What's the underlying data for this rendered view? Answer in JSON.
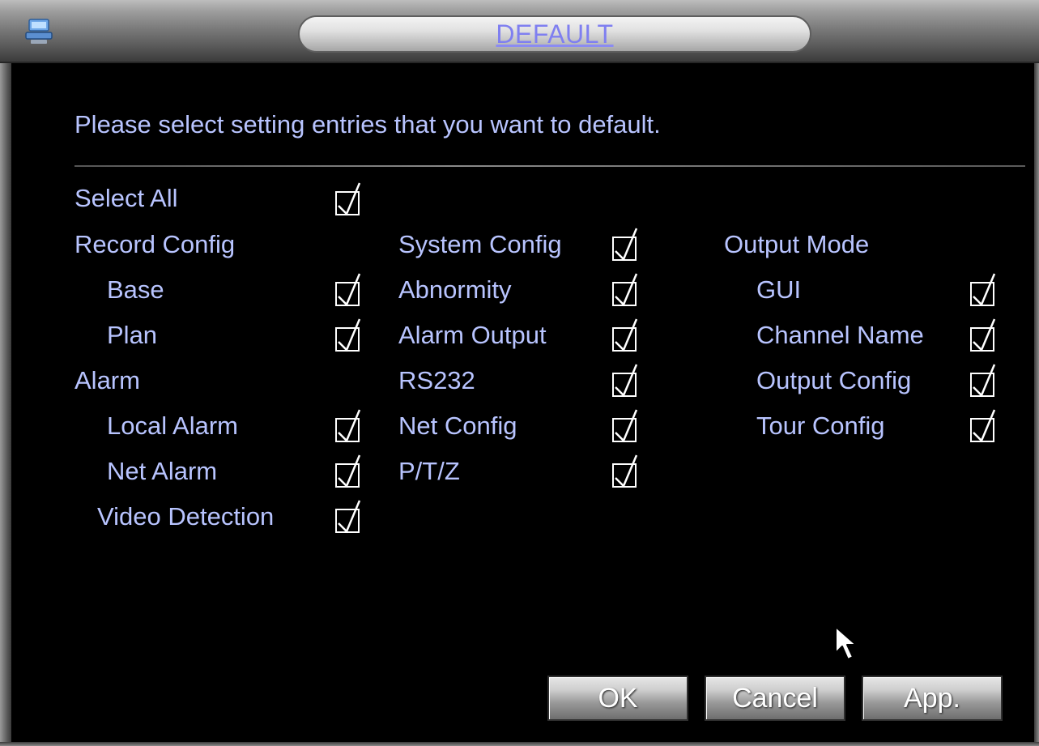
{
  "window": {
    "title": "DEFAULT"
  },
  "prompt": "Please select setting entries that you want to default.",
  "select_all": {
    "label": "Select All",
    "checked": true
  },
  "columns": {
    "left": {
      "group1": {
        "label": "Record Config"
      },
      "base": {
        "label": "Base",
        "checked": true
      },
      "plan": {
        "label": "Plan",
        "checked": true
      },
      "group2": {
        "label": "Alarm"
      },
      "local_alarm": {
        "label": "Local Alarm",
        "checked": true
      },
      "net_alarm": {
        "label": "Net Alarm",
        "checked": true
      },
      "video_detection": {
        "label": "Video Detection",
        "checked": true
      }
    },
    "middle": {
      "system_config": {
        "label": "System Config",
        "checked": true
      },
      "abnormity": {
        "label": "Abnormity",
        "checked": true
      },
      "alarm_output": {
        "label": "Alarm Output",
        "checked": true
      },
      "rs232": {
        "label": "RS232",
        "checked": true
      },
      "net_config": {
        "label": "Net Config",
        "checked": true
      },
      "ptz": {
        "label": "P/T/Z",
        "checked": true
      }
    },
    "right": {
      "group1": {
        "label": "Output Mode"
      },
      "gui": {
        "label": "GUI",
        "checked": true
      },
      "channel_name": {
        "label": "Channel Name",
        "checked": true
      },
      "output_config": {
        "label": "Output Config",
        "checked": true
      },
      "tour_config": {
        "label": "Tour Config",
        "checked": true
      }
    }
  },
  "buttons": {
    "ok": "OK",
    "cancel": "Cancel",
    "apply": "App."
  },
  "colors": {
    "background": "#000000",
    "label_text": "#b8c4ff",
    "title_text": "#7f7ff0",
    "checkbox_border": "#ffffff",
    "button_text": "#ffffff"
  },
  "icons": {
    "app": "monitor-icon",
    "checkmark": "checkmark-icon",
    "cursor": "mouse-pointer-icon"
  }
}
